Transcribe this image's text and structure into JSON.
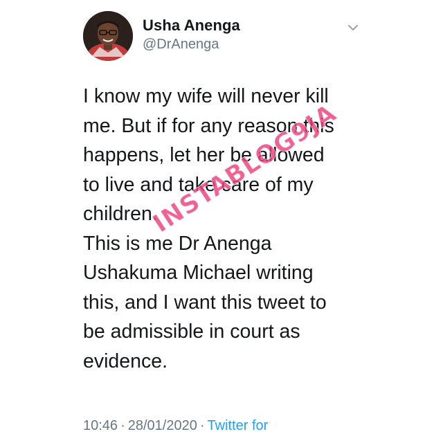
{
  "tweet": {
    "author": {
      "display_name": "Usha Anenga",
      "handle": "@DrAnenga",
      "avatar_icon": "profile-photo"
    },
    "menu_icon": "chevron-down-icon",
    "text_lines": [
      "I know my wife will never kill",
      "me. But if for any reason this",
      "happens, let her be allowed",
      "to live and take care of my",
      "children.",
      "This is me Dr Anenga",
      "Ushakuma Michael writing",
      "this, and I want this tweet to",
      "be admissible in court as",
      "evidence."
    ],
    "time": "10:46",
    "separator": "·",
    "date": "28/01/2020",
    "source": "Twitter for"
  },
  "watermark": "INSTABLOG9JA",
  "colors": {
    "text": "#14171a",
    "secondary": "#657786",
    "link": "#1da1f2",
    "watermark": "#ec407a"
  }
}
